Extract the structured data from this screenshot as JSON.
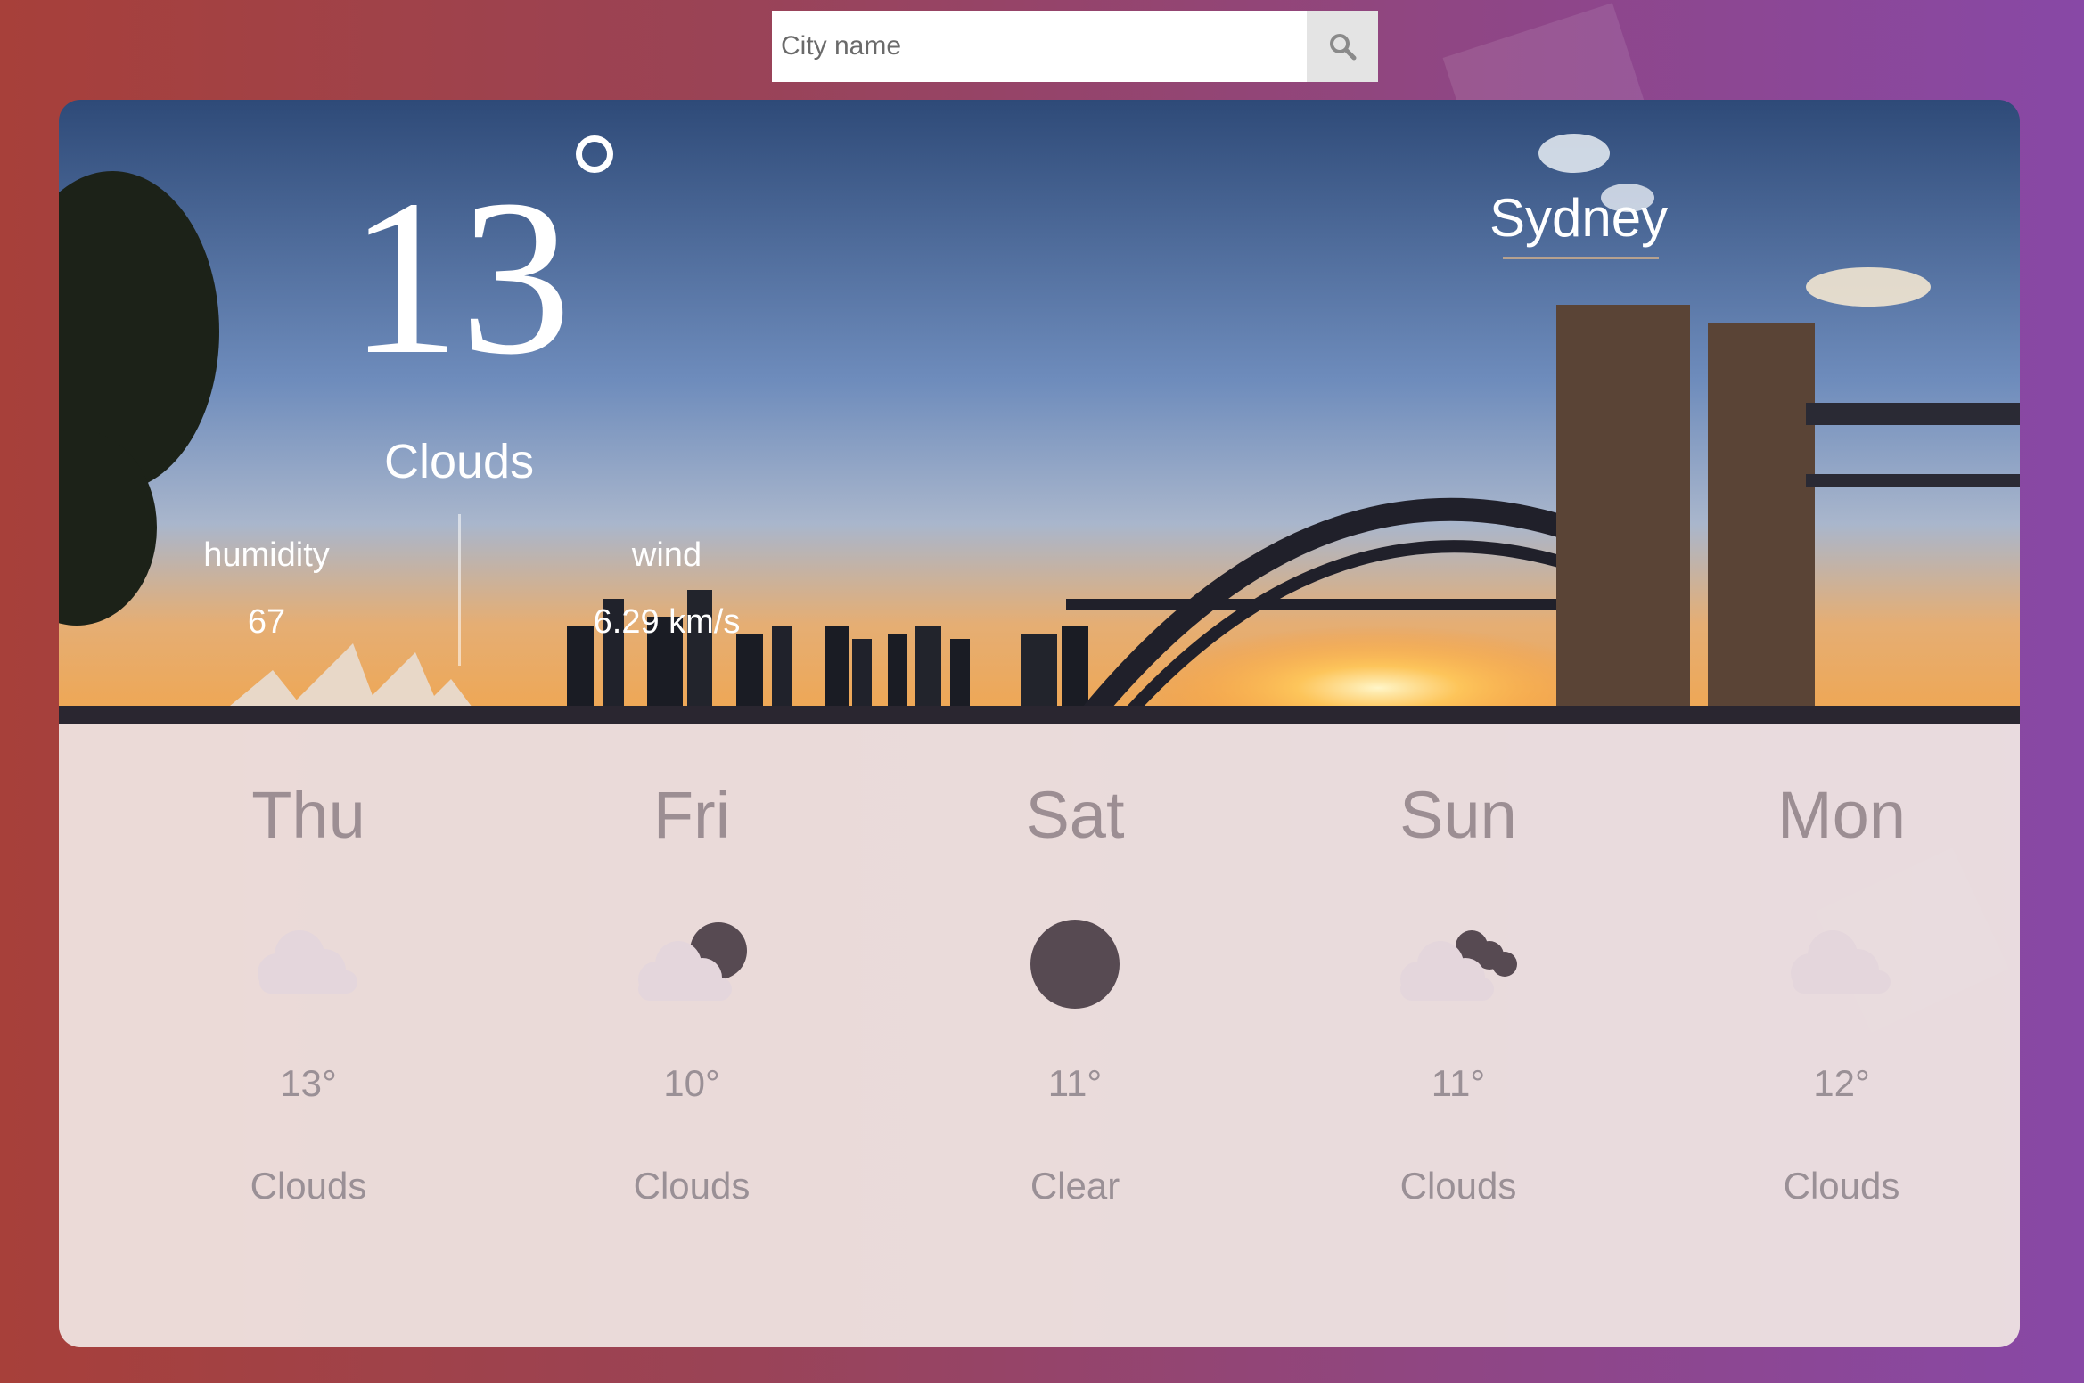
{
  "search": {
    "placeholder": "City name",
    "button_icon": "search-icon"
  },
  "current": {
    "temperature": "13",
    "condition": "Clouds",
    "city": "Sydney",
    "humidity_label": "humidity",
    "humidity_value": "67",
    "wind_label": "wind",
    "wind_value": "6.29 km/s"
  },
  "forecast": [
    {
      "day": "Thu",
      "temp": "13°",
      "desc": "Clouds",
      "icon": "cloud-icon"
    },
    {
      "day": "Fri",
      "temp": "10°",
      "desc": "Clouds",
      "icon": "moon-cloud-icon"
    },
    {
      "day": "Sat",
      "temp": "11°",
      "desc": "Clear",
      "icon": "moon-icon"
    },
    {
      "day": "Sun",
      "temp": "11°",
      "desc": "Clouds",
      "icon": "dark-clouds-icon"
    },
    {
      "day": "Mon",
      "temp": "12°",
      "desc": "Clouds",
      "icon": "cloud-icon"
    }
  ],
  "colors": {
    "background_start": "#a7403a",
    "background_end": "#8848a6",
    "forecast_panel": "#e9dfdc",
    "icon_dark": "#574a52",
    "icon_light": "#e4d6dc"
  }
}
